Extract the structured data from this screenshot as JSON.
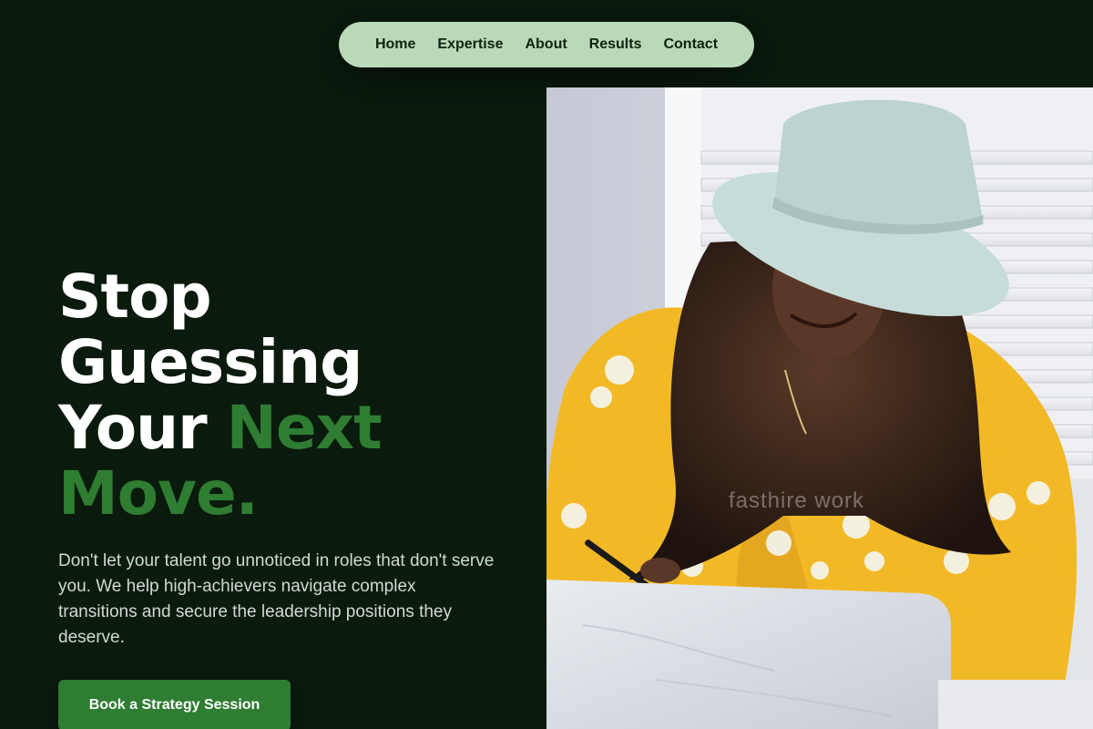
{
  "nav": {
    "items": [
      {
        "label": "Home"
      },
      {
        "label": "Expertise"
      },
      {
        "label": "About"
      },
      {
        "label": "Results"
      },
      {
        "label": "Contact"
      }
    ]
  },
  "hero": {
    "title_line1": "Stop",
    "title_line2": "Guessing",
    "title_line3_white": "Your",
    "title_line3_accent": "Next",
    "title_line4_accent": "Move.",
    "subtitle": "Don't let your talent go unnoticed in roles that don't serve you. We help high-achievers navigate complex transitions and secure the leadership positions they deserve.",
    "cta_label": "Book a Strategy Session"
  },
  "photo": {
    "watermark": "fasthire work",
    "alt": "Woman in a yellow floral blouse and light hat writing at a desk"
  },
  "colors": {
    "background": "#0a1a0d",
    "nav_pill": "#b9d9b9",
    "accent": "#2e7d32",
    "text": "#ffffff"
  }
}
